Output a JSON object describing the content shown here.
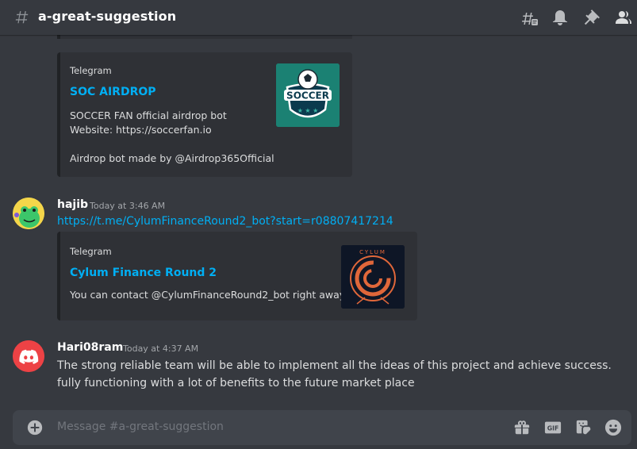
{
  "channel": {
    "name": "a-great-suggestion"
  },
  "header": {
    "icons": [
      "threads-icon",
      "bell-icon",
      "pin-icon",
      "members-icon"
    ]
  },
  "messages": {
    "embed1": {
      "provider": "Telegram",
      "title": "SOC AIRDROP",
      "description": "SOCCER FAN official airdrop bot\nWebsite: https://soccerfan.io\n\nAirdrop bot made by @Airdrop365Official",
      "thumb_text": "SOCCER"
    },
    "msg2": {
      "username": "hajib",
      "timestamp": "Today at 3:46 AM",
      "link": "https://t.me/CylumFinanceRound2_bot?start=r08807417214",
      "embed": {
        "provider": "Telegram",
        "title": "Cylum Finance Round 2",
        "description": "You can contact @CylumFinanceRound2_bot right away.",
        "thumb_text": "CYLUM"
      }
    },
    "msg3": {
      "username": "Hari08ram",
      "timestamp": "Today at 4:37 AM",
      "line1": "The strong reliable team will be able to implement all the ideas of this project and achieve success.",
      "line2": "fully functioning with a lot of benefits to the future market place"
    }
  },
  "composer": {
    "placeholder": "Message #a-great-suggestion",
    "gif_label": "GIF"
  },
  "colors": {
    "background": "#36393f",
    "embed_bg": "#2f3136",
    "link": "#00aff4",
    "discord_red": "#ed4245",
    "composer_bg": "#40444b"
  }
}
